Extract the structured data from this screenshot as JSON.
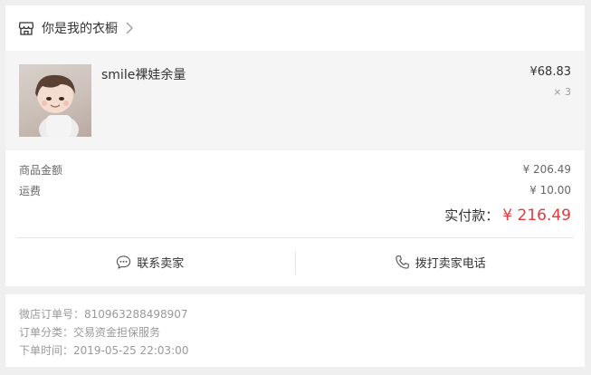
{
  "shop": {
    "name": "你是我的衣橱",
    "icon": "store-icon",
    "arrow_icon": "chevron-right-icon"
  },
  "product": {
    "title": "smile裸娃余量",
    "price": "¥68.83",
    "quantity": "× 3"
  },
  "summary": {
    "goods_label": "商品金额",
    "goods_value": "¥ 206.49",
    "shipping_label": "运费",
    "shipping_value": "¥ 10.00",
    "paid_label": "实付款：",
    "paid_value": "¥ 216.49"
  },
  "actions": {
    "contact_label": "联系卖家",
    "contact_icon": "chat-bubble-icon",
    "call_label": "拨打卖家电话",
    "call_icon": "phone-icon"
  },
  "order_meta": {
    "order_no": "微店订单号：810963288498907",
    "category": "订单分类：交易资金担保服务",
    "time": "下单时间：2019-05-25 22:03:00"
  },
  "colors": {
    "accent_price": "#e4393c",
    "background": "#efefef"
  }
}
